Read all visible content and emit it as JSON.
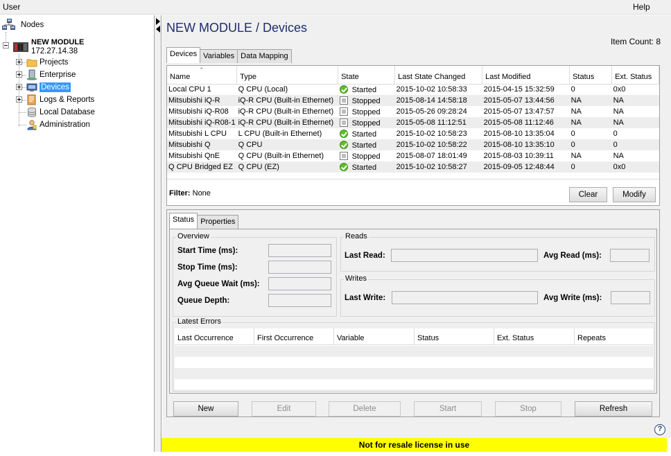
{
  "menu": {
    "user": "User",
    "help": "Help"
  },
  "tree": {
    "root": "Nodes",
    "module_name": "NEW MODULE",
    "module_ip": "172.27.14.38",
    "items": [
      {
        "label": "Projects",
        "icon": "folder-icon"
      },
      {
        "label": "Enterprise",
        "icon": "enterprise-icon"
      },
      {
        "label": "Devices",
        "icon": "devices-icon",
        "selected": true
      },
      {
        "label": "Logs & Reports",
        "icon": "logs-icon"
      },
      {
        "label": "Local Database",
        "icon": "database-icon"
      },
      {
        "label": "Administration",
        "icon": "admin-icon"
      }
    ]
  },
  "page": {
    "title": "NEW MODULE / Devices",
    "item_count": "Item Count: 8"
  },
  "top_tabs": [
    "Devices",
    "Variables",
    "Data Mapping"
  ],
  "devices_table": {
    "columns": [
      "Name",
      "Type",
      "State",
      "Last State Changed",
      "Last Modified",
      "Status",
      "Ext. Status"
    ],
    "rows": [
      {
        "name": "Local CPU 1",
        "type": "Q CPU (Local)",
        "state": "Started",
        "changed": "2015-10-02 10:58:33",
        "modified": "2015-04-15 15:32:59",
        "status": "0",
        "ext": "0x0"
      },
      {
        "name": "Mitsubishi iQ-R",
        "type": "iQ-R CPU (Built-in Ethernet)",
        "state": "Stopped",
        "changed": "2015-08-14 14:58:18",
        "modified": "2015-05-07 13:44:56",
        "status": "NA",
        "ext": "NA"
      },
      {
        "name": "Mitsubishi iQ-R08",
        "type": "iQ-R CPU (Built-in Ethernet)",
        "state": "Stopped",
        "changed": "2015-05-26 09:28:24",
        "modified": "2015-05-07 13:47:57",
        "status": "NA",
        "ext": "NA"
      },
      {
        "name": "Mitsubishi iQ-R08-1",
        "type": "iQ-R CPU (Built-in Ethernet)",
        "state": "Stopped",
        "changed": "2015-05-08 11:12:51",
        "modified": "2015-05-08 11:12:46",
        "status": "NA",
        "ext": "NA"
      },
      {
        "name": "Mitsubishi L CPU",
        "type": "L CPU (Built-in Ethernet)",
        "state": "Started",
        "changed": "2015-10-02 10:58:23",
        "modified": "2015-08-10 13:35:04",
        "status": "0",
        "ext": "0"
      },
      {
        "name": "Mitsubishi Q",
        "type": "Q CPU",
        "state": "Started",
        "changed": "2015-10-02 10:58:22",
        "modified": "2015-08-10 13:35:10",
        "status": "0",
        "ext": "0"
      },
      {
        "name": "Mitsubishi QnE",
        "type": "Q CPU (Built-in Ethernet)",
        "state": "Stopped",
        "changed": "2015-08-07 18:01:49",
        "modified": "2015-08-03 10:39:11",
        "status": "NA",
        "ext": "NA"
      },
      {
        "name": "Q CPU Bridged EZ",
        "type": "Q CPU (EZ)",
        "state": "Started",
        "changed": "2015-10-02 10:58:27",
        "modified": "2015-09-05 12:48:44",
        "status": "0",
        "ext": "0x0"
      }
    ]
  },
  "filter": {
    "label": "Filter:",
    "value": "None",
    "clear": "Clear",
    "modify": "Modify"
  },
  "bottom_tabs": [
    "Status",
    "Properties"
  ],
  "overview": {
    "legend": "Overview",
    "start_time": "Start Time (ms):",
    "stop_time": "Stop Time (ms):",
    "avg_queue": "Avg Queue Wait (ms):",
    "queue_depth": "Queue Depth:"
  },
  "reads": {
    "legend": "Reads",
    "last_read": "Last Read:",
    "avg_read": "Avg Read (ms):"
  },
  "writes": {
    "legend": "Writes",
    "last_write": "Last Write:",
    "avg_write": "Avg Write (ms):"
  },
  "latest_errors": {
    "legend": "Latest Errors",
    "columns": [
      "Last Occurrence",
      "First Occurrence",
      "Variable",
      "Status",
      "Ext. Status",
      "Repeats"
    ]
  },
  "actions": {
    "new": "New",
    "edit": "Edit",
    "delete": "Delete",
    "start": "Start",
    "stop": "Stop",
    "refresh": "Refresh"
  },
  "license": "Not for resale license in use",
  "help_glyph": "?",
  "colors": {
    "title": "#1f2d6b",
    "selection": "#3399ff",
    "license_bar": "#ffff00",
    "started": "#5cbf2a"
  }
}
